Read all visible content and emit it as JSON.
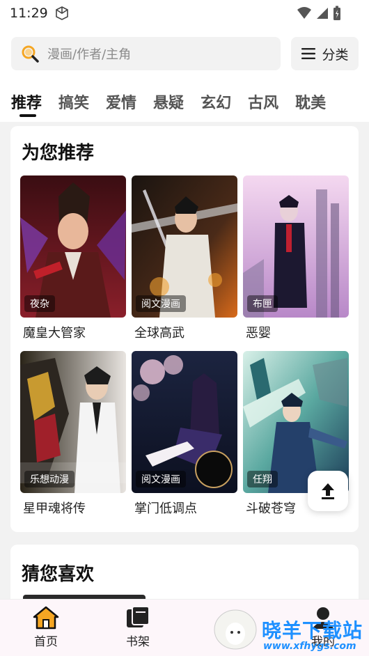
{
  "status_bar": {
    "time": "11:29"
  },
  "search": {
    "placeholder": "漫画/作者/主角"
  },
  "category_button": {
    "label": "分类"
  },
  "tabs": [
    {
      "label": "推荐",
      "active": true
    },
    {
      "label": "搞笑"
    },
    {
      "label": "爱情"
    },
    {
      "label": "悬疑"
    },
    {
      "label": "玄幻"
    },
    {
      "label": "古风"
    },
    {
      "label": "耽美"
    }
  ],
  "recommend": {
    "title": "为您推荐",
    "items": [
      {
        "title": "魔皇大管家",
        "badge": "夜杂"
      },
      {
        "title": "全球高武",
        "badge": "阅文漫画"
      },
      {
        "title": "恶婴",
        "badge": "布匣"
      },
      {
        "title": "星甲魂将传",
        "badge": "乐想动漫"
      },
      {
        "title": "掌门低调点",
        "badge": "阅文漫画"
      },
      {
        "title": "斗破苍穹",
        "badge": "任翔"
      }
    ]
  },
  "guess": {
    "title": "猜您喜欢"
  },
  "bottom_nav": {
    "home": "首页",
    "shelf": "书架",
    "mine": "我的"
  },
  "watermark": {
    "main": "晓羊下载站",
    "url": "www.xfhygs.com"
  },
  "colors": {
    "accent": "#f5a623",
    "active_tab": "#111111",
    "page_bg": "#f2f2f2"
  }
}
